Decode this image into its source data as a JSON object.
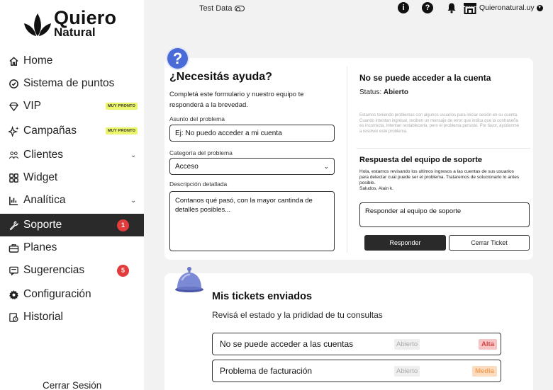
{
  "brand": {
    "line1": "Quiero",
    "line2": "Natural"
  },
  "topbar": {
    "test_data_label": "Test Data",
    "info_icon": "info-icon",
    "help_icon": "help-icon",
    "bell_icon": "bell-icon",
    "store_icon": "store-icon",
    "store_name": "Quieronatural.uy"
  },
  "sidebar": {
    "items": [
      {
        "label": "Home",
        "icon": "home-icon"
      },
      {
        "label": "Sistema de puntos",
        "icon": "points-icon"
      },
      {
        "label": "VIP",
        "icon": "diamond-icon",
        "tag": "MUY PRONTO"
      },
      {
        "label": "Campañas",
        "icon": "sparkles-icon",
        "tag": "MUY PRONTO"
      },
      {
        "label": "Clientes",
        "icon": "users-icon",
        "expandable": true
      },
      {
        "label": "Widget",
        "icon": "widget-icon"
      },
      {
        "label": "Analítica",
        "icon": "chart-icon",
        "expandable": true
      },
      {
        "label": "Soporte",
        "icon": "wrench-icon",
        "count": "1",
        "active": true
      },
      {
        "label": "Planes",
        "icon": "briefcase-icon"
      },
      {
        "label": "Sugerencias",
        "icon": "message-icon",
        "count": "5"
      },
      {
        "label": "Configuración",
        "icon": "gear-icon"
      },
      {
        "label": "Historial",
        "icon": "history-icon"
      }
    ],
    "logout_label": "Cerrar Sesión"
  },
  "help_form": {
    "badge": "?",
    "title": "¿Necesitás ayuda?",
    "subtitle": "Completá este formulario y nuestro equipo te responderá a la brevedad.",
    "subject_label": "Asunto del problema",
    "subject_value": "Ej: No puedo acceder a mi cuenta",
    "category_label": "Categoría del problema",
    "category_value": "Acceso",
    "description_label": "Descripción detallada",
    "description_value": "Contanos qué pasó, con la mayor cantinda de detalles posibles..."
  },
  "ticket_detail": {
    "title": "No se puede acceder a la cuenta",
    "status_label": "Status:",
    "status_value": "Abierto",
    "description": "Estamos teniendo problemas con algunos usuarios para iniciar sesión en su cuenta. Cuando intentan ingresar, reciben un mensaje de error que indica que la contraseña es incorrecta. Intentan restablecerla, pero el problema persiste. Por favor, ayúdenme a resolver este problema.",
    "response_title": "Respuesta del equipo de soporte",
    "response_text": "Hola, estamos revisando los ultimos ingresos a las cuentas de sus usuarios para detectar cual puede ser el problema. Trataremos de solucionarlo lo antes posible.",
    "response_sign": "Saludos, Alain k.",
    "reply_placeholder": "Responder al equipo de soporte",
    "reply_button": "Responder",
    "close_button": "Cerrar Ticket"
  },
  "tickets": {
    "title": "Mis tickets enviados",
    "subtitle": "Revisá el estado y la prididad de tu consultas",
    "rows": [
      {
        "name": "No se puede acceder a las cuentas",
        "status": "Abierto",
        "priority": "Alta"
      },
      {
        "name": "Problema de facturación",
        "status": "Abierto",
        "priority": "Media"
      }
    ]
  },
  "colors": {
    "sidebar_active": "#2a2a2a",
    "badge_red": "#e23b3b",
    "tag_yellow": "#eaf56a",
    "help_blue": "#4a6ad8",
    "priority_high": "#d64545",
    "priority_medium": "#f3a058"
  }
}
